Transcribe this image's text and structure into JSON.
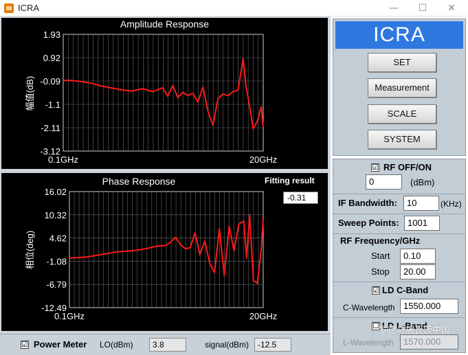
{
  "window": {
    "title": "ICRA",
    "minimize_glyph": "—",
    "maximize_glyph": "☐",
    "close_glyph": "✕"
  },
  "charts": {
    "amplitude": {
      "title": "Amplitude Response",
      "ylabel": "幅值(dB)",
      "yticks": [
        "1.93",
        "0.92",
        "-0.09",
        "-1.1",
        "-2.11",
        "-3.12"
      ],
      "xticks": [
        "0.1GHz",
        "20GHz"
      ]
    },
    "phase": {
      "title": "Phase Response",
      "ylabel": "相位(deg)",
      "yticks": [
        "16.02",
        "10.32",
        "4.62",
        "-1.08",
        "-6.79",
        "-12.49"
      ],
      "xticks": [
        "0.1GHz",
        "20GHz"
      ]
    }
  },
  "chart_data": [
    {
      "type": "line",
      "title": "Amplitude Response",
      "xlabel": "",
      "ylabel": "幅值(dB)",
      "xlim": [
        0.1,
        20
      ],
      "ylim": [
        -3.12,
        1.93
      ],
      "grid": true,
      "series": [
        {
          "color": "#ff1a1a",
          "x": [
            0.1,
            1,
            2,
            3,
            4,
            5,
            6,
            7,
            8,
            9,
            10,
            10.5,
            11,
            11.5,
            12,
            12.5,
            13,
            13.5,
            14,
            14.5,
            15,
            15.5,
            16,
            16.5,
            17,
            17.5,
            18,
            18.3,
            18.6,
            19,
            19.4,
            19.8,
            20
          ],
          "y": [
            -0.06,
            -0.07,
            -0.12,
            -0.2,
            -0.32,
            -0.4,
            -0.48,
            -0.52,
            -0.42,
            -0.55,
            -0.38,
            -0.75,
            -0.28,
            -0.8,
            -0.58,
            -0.72,
            -0.62,
            -1.0,
            -0.35,
            -1.4,
            -2.0,
            -0.85,
            -0.65,
            -0.72,
            -0.55,
            -0.48,
            0.88,
            -0.35,
            -1.05,
            -2.15,
            -1.85,
            -1.2,
            -2.1
          ]
        }
      ]
    },
    {
      "type": "line",
      "title": "Phase Response",
      "xlabel": "",
      "ylabel": "相位(deg)",
      "xlim": [
        0.1,
        20
      ],
      "ylim": [
        -12.49,
        16.02
      ],
      "grid": true,
      "series": [
        {
          "color": "#ff1a1a",
          "x": [
            0.1,
            1,
            2,
            3,
            4,
            5,
            6,
            7,
            8,
            9,
            10,
            10.5,
            11,
            11.5,
            12,
            12.5,
            13,
            13.5,
            14,
            14.5,
            15,
            15.5,
            16,
            16.5,
            17,
            17.5,
            18,
            18.3,
            18.6,
            19,
            19.4,
            19.8,
            20
          ],
          "y": [
            -0.3,
            -0.2,
            0,
            0.4,
            0.8,
            1.2,
            1.4,
            1.6,
            2.0,
            2.6,
            2.8,
            3.6,
            4.8,
            3.0,
            2.0,
            2.2,
            5.9,
            0.5,
            3.9,
            -1.5,
            -3.9,
            6.9,
            -4.6,
            7.5,
            1.5,
            8.0,
            8.8,
            -0.3,
            10.3,
            -5.8,
            -6.5,
            2.0,
            9.5
          ]
        }
      ]
    }
  ],
  "fitting": {
    "label": "Fitting result",
    "value": "-0.31"
  },
  "power_meter": {
    "checked": "☑",
    "label": "Power Meter",
    "lo_label": "LO(dBm)",
    "lo_value": "3.8",
    "signal_label": "signal(dBm)",
    "signal_value": "-12.5"
  },
  "menu": {
    "header": "ICRA",
    "buttons": [
      "SET",
      "Measurement",
      "SCALE",
      "SYSTEM"
    ]
  },
  "settings": {
    "rf_checked": "☑",
    "rf_label": "RF OFF/ON",
    "rf_power_value": "0",
    "rf_power_unit": "(dBm)",
    "if_label": "IF Bandwidth:",
    "if_value": "10",
    "if_unit": "(KHz)",
    "sweep_label": "Sweep Points:",
    "sweep_value": "1001",
    "freq_label": "RF Frequency/GHz",
    "start_label": "Start",
    "start_value": "0.10",
    "stop_label": "Stop",
    "stop_value": "20.00",
    "ldc_checked": "☑",
    "ldc_label": "LD C-Band",
    "cwl_label": "C-Wavelength",
    "cwl_value": "1550.000",
    "ldl_checked": "☐",
    "ldl_label": "LD L-Band",
    "lwl_label": "L-Wavelength",
    "lwl_value": "1570.000"
  },
  "watermark": "罗德与施瓦茨中国"
}
